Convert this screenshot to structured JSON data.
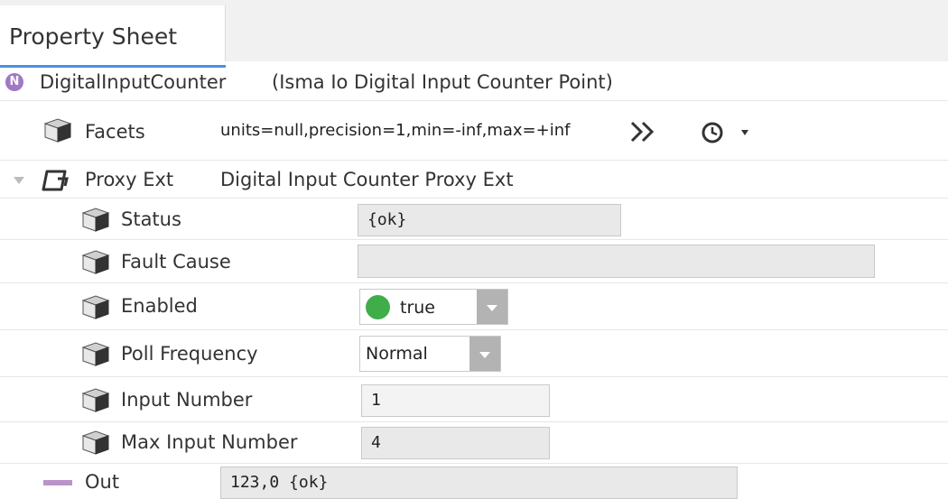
{
  "tab": {
    "label": "Property Sheet"
  },
  "header": {
    "badge": "N",
    "component": "DigitalInputCounter",
    "type_label": "(Isma Io Digital Input Counter Point)"
  },
  "facets": {
    "label": "Facets",
    "value": "units=null,precision=1,min=-inf,max=+inf"
  },
  "proxy_ext": {
    "label": "Proxy Ext",
    "value": "Digital Input Counter Proxy Ext"
  },
  "props": {
    "status": {
      "label": "Status",
      "value": "{ok}"
    },
    "fault_cause": {
      "label": "Fault Cause",
      "value": ""
    },
    "enabled": {
      "label": "Enabled",
      "value": "true",
      "indicator_color": "#3fae49"
    },
    "poll_frequency": {
      "label": "Poll Frequency",
      "value": "Normal"
    },
    "input_number": {
      "label": "Input Number",
      "value": "1"
    },
    "max_input_number": {
      "label": "Max Input Number",
      "value": "4"
    }
  },
  "out": {
    "label": "Out",
    "value": "123,0 {ok}",
    "color": "#b993c9"
  }
}
